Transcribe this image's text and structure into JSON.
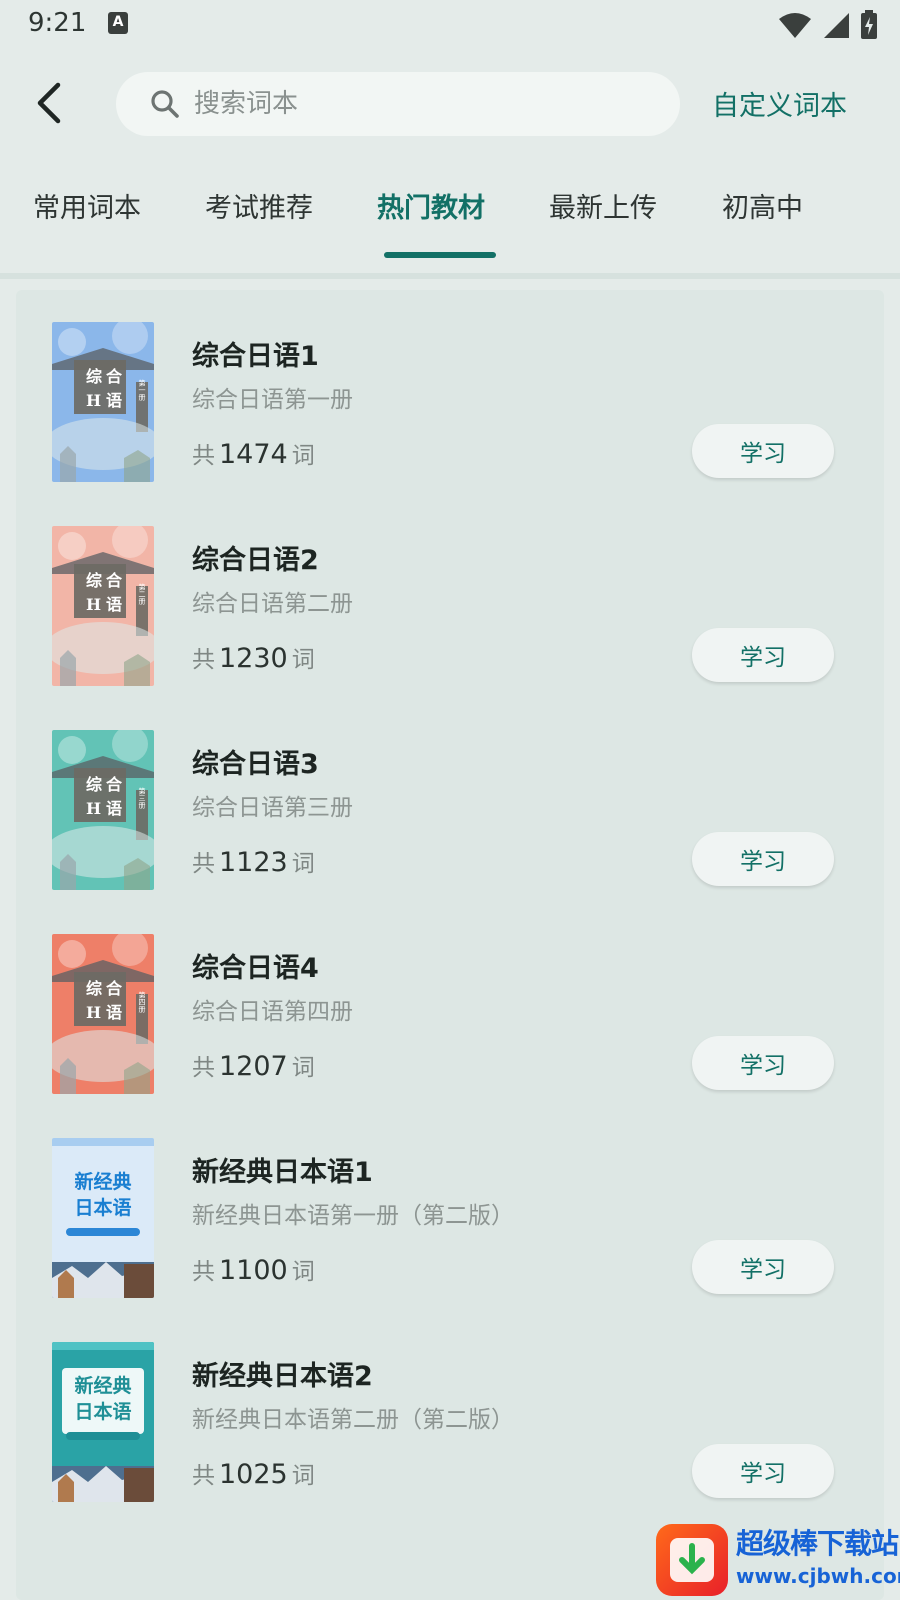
{
  "status_bar": {
    "time": "9:21",
    "notification_badge": "A"
  },
  "header": {
    "search_placeholder": "搜索词本",
    "custom_label": "自定义词本"
  },
  "tabs": [
    {
      "label": "常用词本",
      "active": false
    },
    {
      "label": "考试推荐",
      "active": false
    },
    {
      "label": "热门教材",
      "active": true
    },
    {
      "label": "最新上传",
      "active": false
    },
    {
      "label": "初高中",
      "active": false
    }
  ],
  "books": [
    {
      "title": "综合日语1",
      "subtitle": "综合日语第一册",
      "count_prefix": "共",
      "count": "1474",
      "count_suffix": "词",
      "button": "学习",
      "cover_style": "zonghe",
      "cover_color": "#8bb7ea",
      "cover_text": [
        "综",
        "合",
        "H",
        "语"
      ],
      "cover_volume": "第一册"
    },
    {
      "title": "综合日语2",
      "subtitle": "综合日语第二册",
      "count_prefix": "共",
      "count": "1230",
      "count_suffix": "词",
      "button": "学习",
      "cover_style": "zonghe",
      "cover_color": "#f2b5a7",
      "cover_text": [
        "综",
        "合",
        "H",
        "语"
      ],
      "cover_volume": "第二册"
    },
    {
      "title": "综合日语3",
      "subtitle": "综合日语第三册",
      "count_prefix": "共",
      "count": "1123",
      "count_suffix": "词",
      "button": "学习",
      "cover_style": "zonghe",
      "cover_color": "#62c3b6",
      "cover_text": [
        "综",
        "合",
        "H",
        "语"
      ],
      "cover_volume": "第三册"
    },
    {
      "title": "综合日语4",
      "subtitle": "综合日语第四册",
      "count_prefix": "共",
      "count": "1207",
      "count_suffix": "词",
      "button": "学习",
      "cover_style": "zonghe",
      "cover_color": "#ee7f68",
      "cover_text": [
        "综",
        "合",
        "H",
        "语"
      ],
      "cover_volume": "第四册"
    },
    {
      "title": "新经典日本语1",
      "subtitle": "新经典日本语第一册（第二版）",
      "count_prefix": "共",
      "count": "1100",
      "count_suffix": "词",
      "button": "学习",
      "cover_style": "xinjingdian",
      "cover_color": "#dbeaf8",
      "cover_text": [
        "新经典",
        "日本语"
      ],
      "cover_volume": ""
    },
    {
      "title": "新经典日本语2",
      "subtitle": "新经典日本语第二册（第二版）",
      "count_prefix": "共",
      "count": "1025",
      "count_suffix": "词",
      "button": "学习",
      "cover_style": "xinjingdian",
      "cover_color": "#2aa3a6",
      "cover_text": [
        "新经典",
        "日本语"
      ],
      "cover_volume": ""
    }
  ],
  "watermark": {
    "title": "超级棒下载站",
    "url": "www.cjbwh.com"
  }
}
